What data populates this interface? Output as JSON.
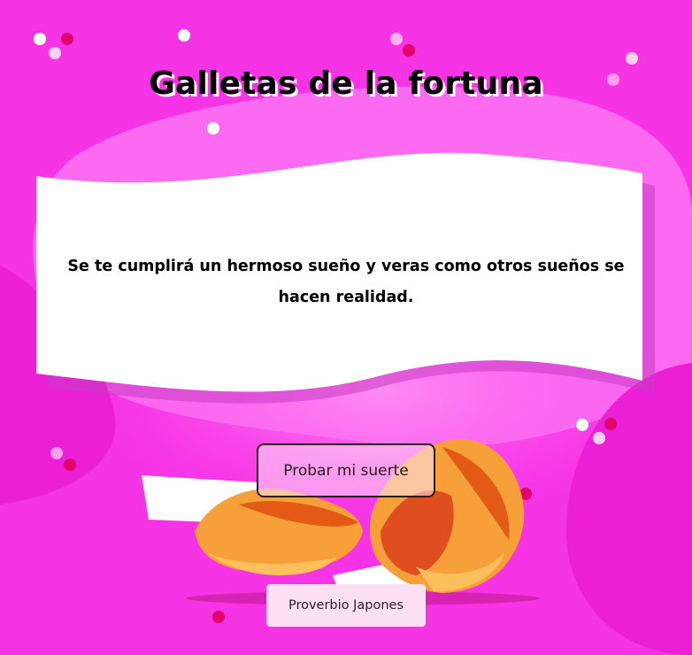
{
  "page": {
    "title": "Galletas de la fortuna"
  },
  "fortune": {
    "message": "Se te cumplirá un hermoso sueño y veras como otros sueños se hacen realidad."
  },
  "actions": {
    "try_luck_label": "Probar mi suerte"
  },
  "source": {
    "label": "Proverbio Japones"
  },
  "theme": {
    "background": "#f733e6",
    "accent_dot": "#e4006a",
    "paper": "#ffffff",
    "cookie_orange": "#f7a03a"
  }
}
